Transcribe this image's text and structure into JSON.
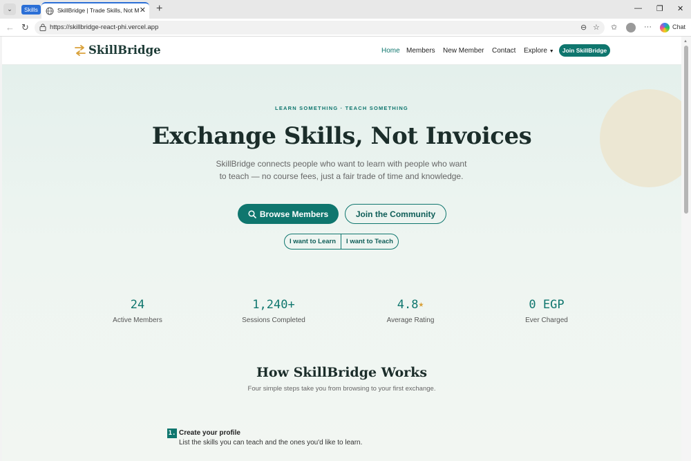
{
  "browser": {
    "group_label": "Skills",
    "tab_title": "SkillBridge | Trade Skills, Not Mone",
    "url": "https://skillbridge-react-phi.vercel.app",
    "chat_label": "Chat"
  },
  "nav": {
    "logo": "SkillBridge",
    "links": [
      "Home",
      "Members",
      "New Member",
      "Contact",
      "Explore"
    ],
    "cta": "Join SkillBridge"
  },
  "hero": {
    "eyebrow": "LEARN SOMETHING · TEACH SOMETHING",
    "title": "Exchange Skills, Not Invoices",
    "subtitle": "SkillBridge connects people who want to learn with people who want to teach — no course fees, just a fair trade of time and knowledge.",
    "primary_btn": "Browse Members",
    "secondary_btn": "Join the Community",
    "toggle": [
      "I want to Learn",
      "I want to Teach"
    ]
  },
  "stats": [
    {
      "value": "24",
      "label": "Active Members"
    },
    {
      "value": "1,240+",
      "label": "Sessions Completed"
    },
    {
      "value": "4.8",
      "label": "Average Rating"
    },
    {
      "value": "0 EGP",
      "label": "Ever Charged"
    }
  ],
  "how": {
    "title": "How SkillBridge Works",
    "subtitle": "Four simple steps take you from browsing to your first exchange.",
    "steps": [
      {
        "num": "1.",
        "title": "Create your profile",
        "desc": "List the skills you can teach and the ones you'd like to learn."
      }
    ]
  },
  "colors": {
    "accent": "#0f766e",
    "star": "#d9a13a",
    "sand": "#ece7d3"
  }
}
